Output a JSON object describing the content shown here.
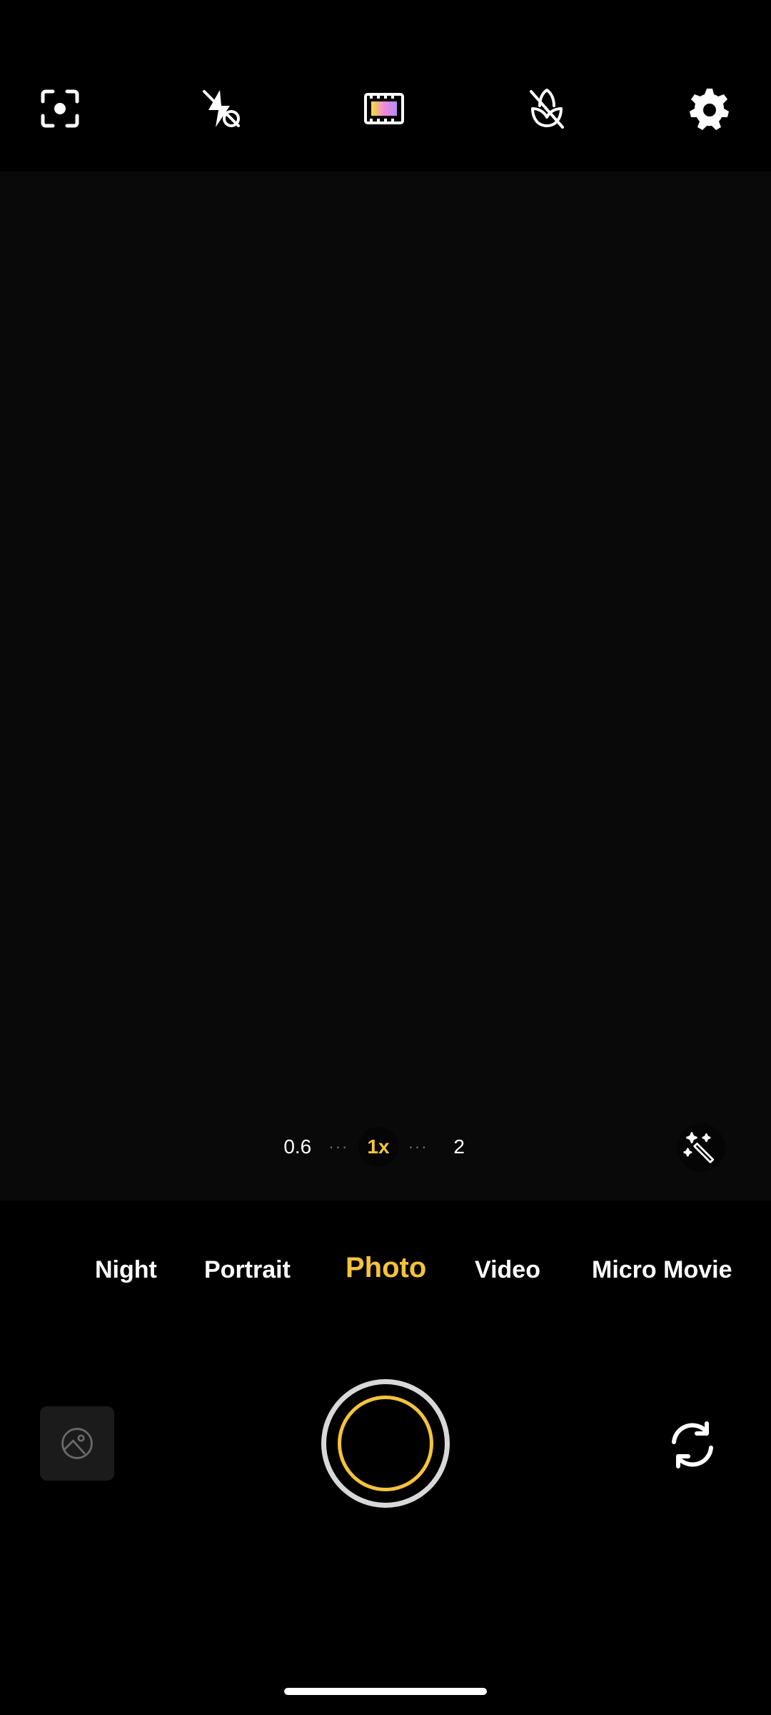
{
  "top_icons": [
    {
      "name": "focus-scan-icon"
    },
    {
      "name": "flash-off-icon"
    },
    {
      "name": "filter-film-icon"
    },
    {
      "name": "macro-off-icon"
    },
    {
      "name": "gear-icon"
    }
  ],
  "zoom": {
    "options": [
      "0.6",
      "1x",
      "2"
    ],
    "active": "1x",
    "dots": "···"
  },
  "modes": [
    "Night",
    "Portrait",
    "Photo",
    "Video",
    "Micro Movie"
  ],
  "active_mode": "Photo",
  "colors": {
    "accent": "#f5c33b",
    "background": "#000000",
    "viewfinder": "#090909"
  }
}
